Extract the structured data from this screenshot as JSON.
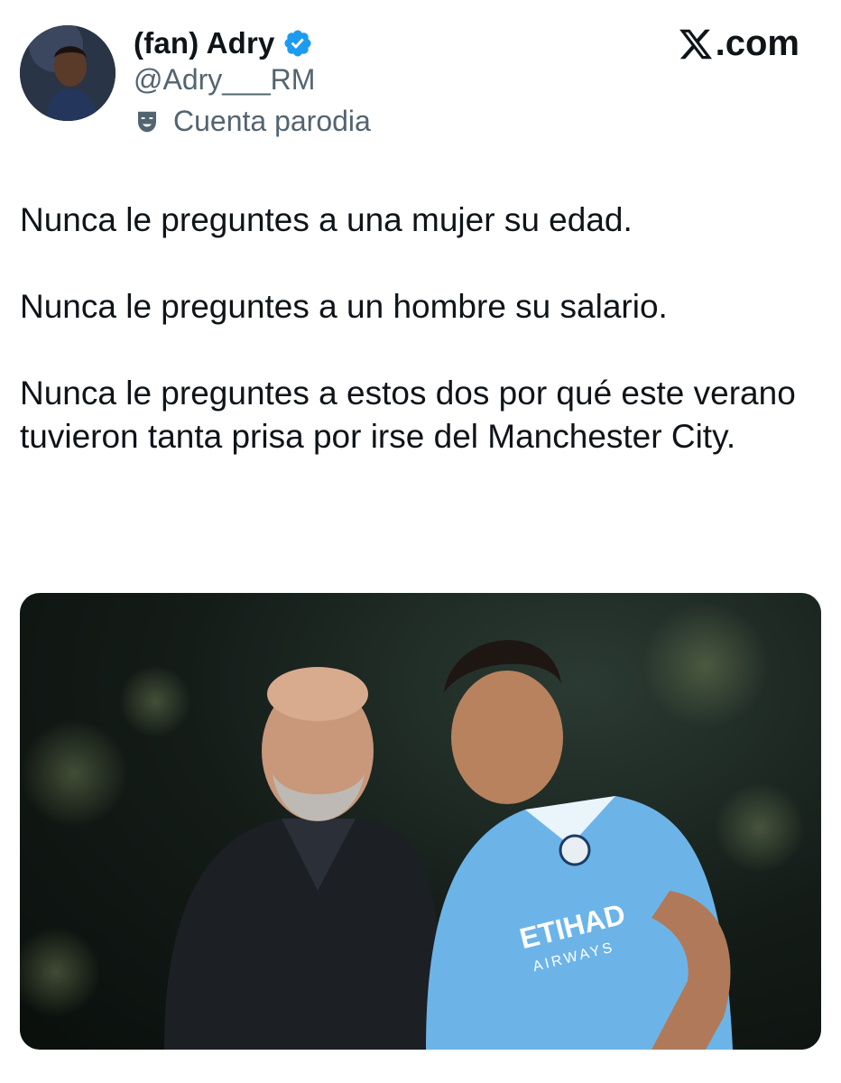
{
  "author": {
    "display_name": "(fan) Adry",
    "handle": "@Adry___RM",
    "verified": true,
    "account_label": "Cuenta parodia",
    "avatar_icon": "avatar-photo",
    "verified_icon": "verified-badge-icon",
    "parody_icon": "parody-mask-icon"
  },
  "brand": {
    "label": ".com",
    "icon": "x-logo-icon"
  },
  "tweet": {
    "paragraphs": [
      "Nunca le preguntes a una mujer su edad.",
      "Nunca le preguntes a un hombre su salario.",
      "Nunca le preguntes a estos dos por qué este verano tuvieron tanta prisa por irse del Manchester City."
    ]
  },
  "media": {
    "shirt_sponsor": "ETIHAD",
    "shirt_sponsor_sub": "AIRWAYS"
  },
  "colors": {
    "text": "#0f1419",
    "secondary": "#536471",
    "verified": "#1d9bf0",
    "kit": "#6cb4e8"
  }
}
